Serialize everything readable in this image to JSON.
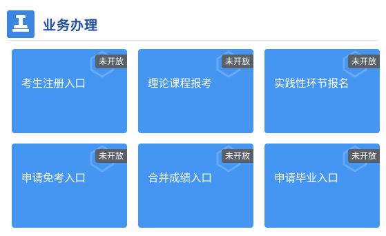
{
  "header": {
    "title": "业务办理",
    "icon": "stamp-icon",
    "accent_color": "#3b86e0",
    "title_color": "#1d4fa5"
  },
  "cards": [
    {
      "label": "考生注册入口",
      "badge": "未开放"
    },
    {
      "label": "理论课程报考",
      "badge": "未开放"
    },
    {
      "label": "实践性环节报名",
      "badge": "未开放"
    },
    {
      "label": "申请免考入口",
      "badge": "未开放"
    },
    {
      "label": "合并成绩入口",
      "badge": "未开放"
    },
    {
      "label": "申请毕业入口",
      "badge": "未开放"
    }
  ],
  "colors": {
    "card_bg": "#4596f3",
    "badge_bg": "#5a6068"
  }
}
